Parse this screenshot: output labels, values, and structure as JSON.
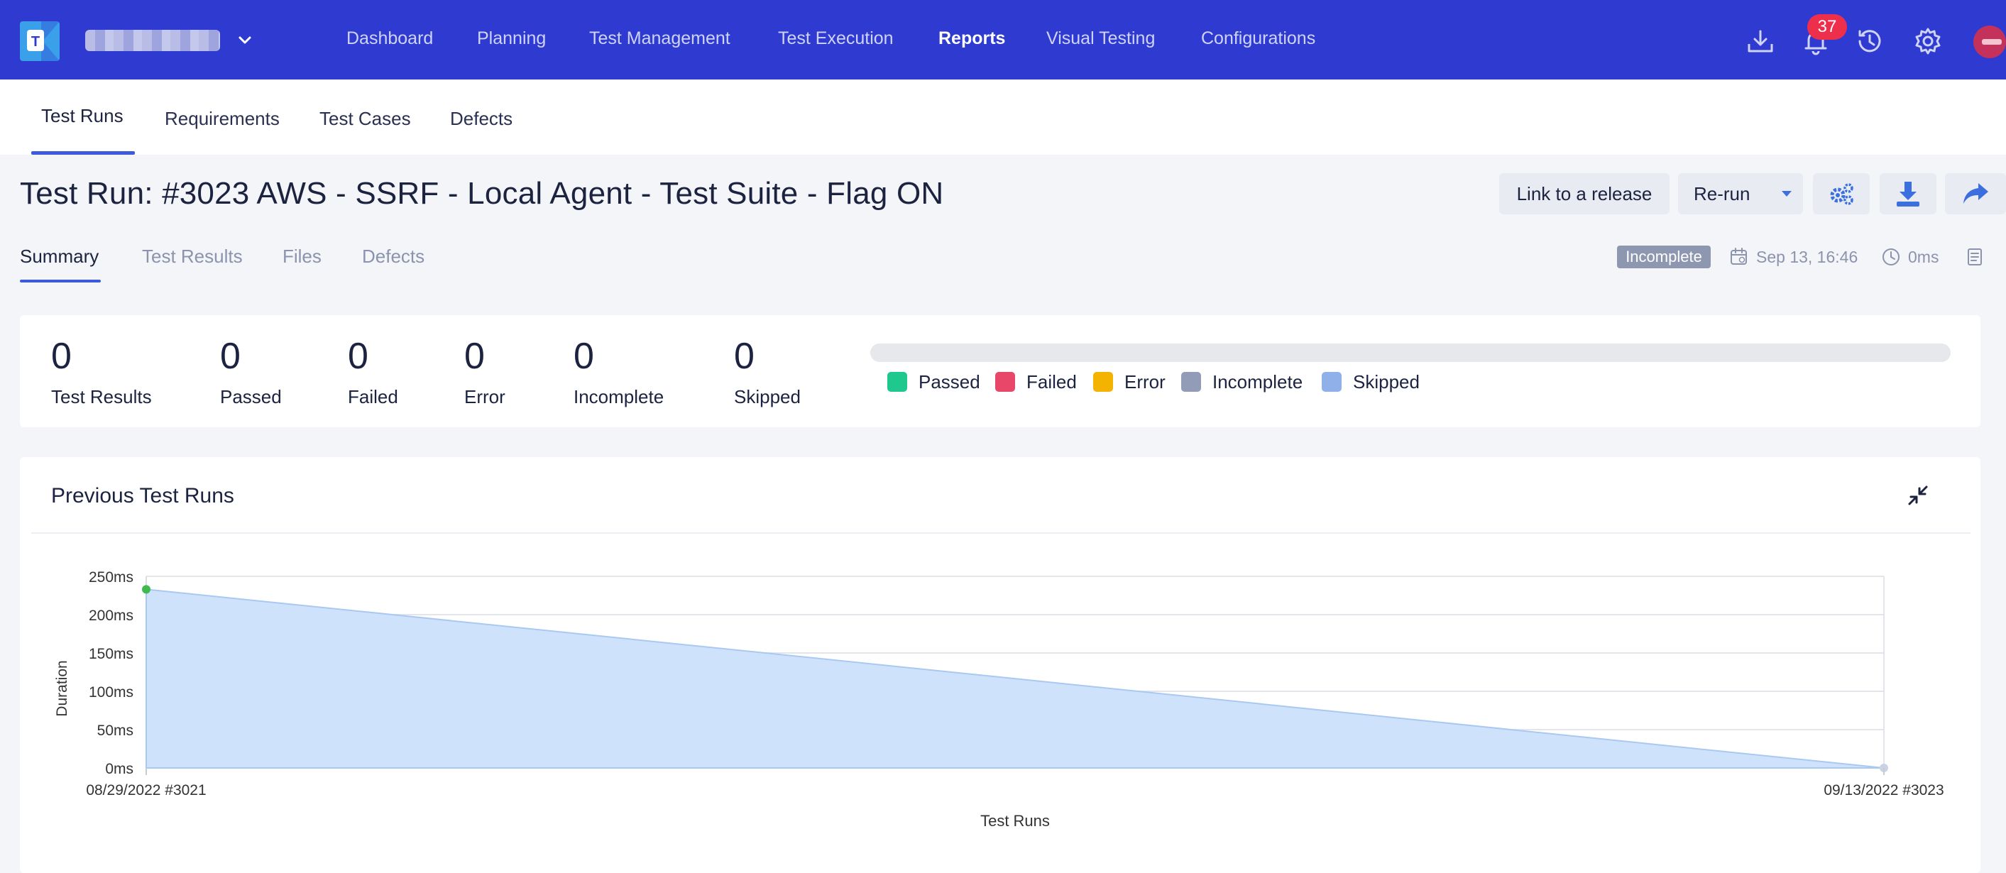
{
  "nav": {
    "items": [
      "Dashboard",
      "Planning",
      "Test Management",
      "Test Execution",
      "Reports",
      "Visual Testing",
      "Configurations"
    ],
    "active": "Reports",
    "notification_count": "37"
  },
  "subtabs": [
    "Test Runs",
    "Requirements",
    "Test Cases",
    "Defects"
  ],
  "run": {
    "title": "Test Run: #3023 AWS - SSRF - Local Agent - Test Suite - Flag ON",
    "link_release_label": "Link to a release",
    "rerun_label": "Re-run",
    "status": "Incomplete",
    "date": "Sep 13, 16:46",
    "duration": "0ms"
  },
  "inner_tabs": [
    "Summary",
    "Test Results",
    "Files",
    "Defects"
  ],
  "stats": [
    {
      "value": "0",
      "label": "Test Results"
    },
    {
      "value": "0",
      "label": "Passed"
    },
    {
      "value": "0",
      "label": "Failed"
    },
    {
      "value": "0",
      "label": "Error"
    },
    {
      "value": "0",
      "label": "Incomplete"
    },
    {
      "value": "0",
      "label": "Skipped"
    }
  ],
  "legend": [
    {
      "label": "Passed",
      "color": "#1fc98e"
    },
    {
      "label": "Failed",
      "color": "#e8476a"
    },
    {
      "label": "Error",
      "color": "#f5b301"
    },
    {
      "label": "Incomplete",
      "color": "#939cb7"
    },
    {
      "label": "Skipped",
      "color": "#8fb0e8"
    }
  ],
  "previous_runs": {
    "title": "Previous Test Runs"
  },
  "colors": {
    "topbar": "#2f3bd0",
    "accent": "#3b5bdb",
    "area_fill": "#cfe2fb",
    "area_line": "#a9c8f2",
    "first_point": "#3fb950"
  },
  "chart_data": {
    "type": "area",
    "x": [
      "08/29/2022 #3021",
      "09/13/2022 #3023"
    ],
    "series": [
      {
        "values": [
          233,
          0
        ]
      }
    ],
    "xlabel": "Test Runs",
    "ylabel": "Duration",
    "ylim": [
      0,
      250
    ],
    "yticks": [
      "0ms",
      "50ms",
      "100ms",
      "150ms",
      "200ms",
      "250ms"
    ],
    "grid": true
  }
}
